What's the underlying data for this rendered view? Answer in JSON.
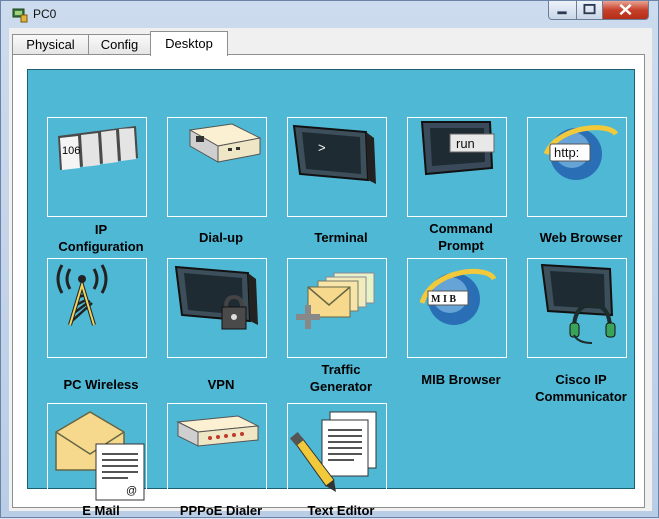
{
  "window": {
    "title": "PC0"
  },
  "tabs": [
    {
      "label": "Physical"
    },
    {
      "label": "Config"
    },
    {
      "label": "Desktop"
    }
  ],
  "apps": [
    {
      "label": "IP\nConfiguration",
      "icon": "ip-configuration-icon"
    },
    {
      "label": "Dial-up",
      "icon": "dial-up-icon"
    },
    {
      "label": "Terminal",
      "icon": "terminal-icon"
    },
    {
      "label": "Command\nPrompt",
      "icon": "command-prompt-icon",
      "icon_text": "run"
    },
    {
      "label": "Web Browser",
      "icon": "web-browser-icon",
      "icon_text": "http:"
    },
    {
      "label": "PC Wireless",
      "icon": "pc-wireless-icon"
    },
    {
      "label": "VPN",
      "icon": "vpn-icon"
    },
    {
      "label": "Traffic\nGenerator",
      "icon": "traffic-generator-icon"
    },
    {
      "label": "MIB Browser",
      "icon": "mib-browser-icon",
      "icon_text": "M I B"
    },
    {
      "label": "Cisco IP\nCommunicator",
      "icon": "cisco-ip-communicator-icon"
    },
    {
      "label": "E Mail",
      "icon": "email-icon"
    },
    {
      "label": "PPPoE Dialer",
      "icon": "pppoe-dialer-icon"
    },
    {
      "label": "Text Editor",
      "icon": "text-editor-icon"
    }
  ],
  "ip_icon_text": "106",
  "colors": {
    "desktop": "#4fb8d5",
    "accent": "#2a6fb5"
  }
}
